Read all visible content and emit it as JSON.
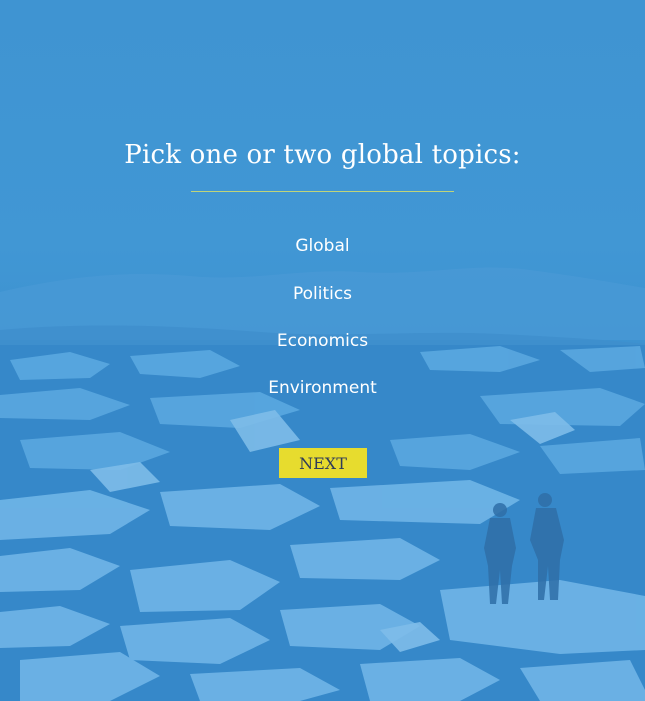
{
  "page": {
    "title": "Pick one or two global topics:",
    "topics": [
      "Global",
      "Politics",
      "Economics",
      "Environment"
    ],
    "next_label": "NEXT"
  },
  "colors": {
    "overlay": "#3f94d2",
    "divider": "#bfd47a",
    "button_bg": "#e7dc2e",
    "button_text": "#2f3c5a"
  }
}
